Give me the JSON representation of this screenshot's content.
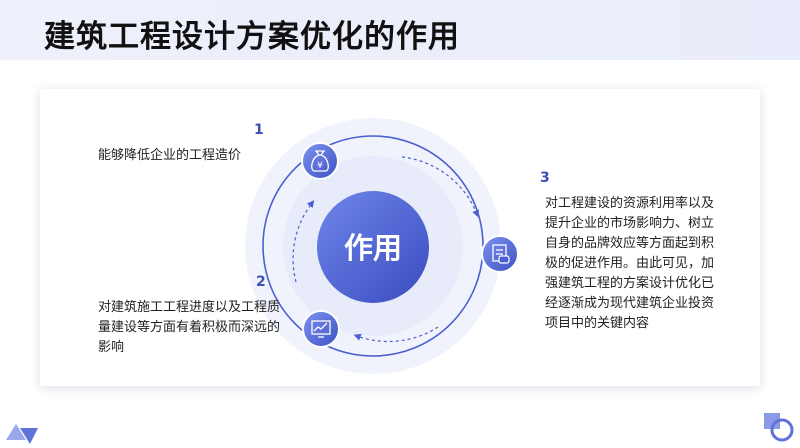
{
  "title": "建筑工程设计方案优化的作用",
  "center_label": "作用",
  "items": [
    {
      "number": "1",
      "text": "能够降低企业的工程造价",
      "icon": "money-bag-icon"
    },
    {
      "number": "2",
      "text": "对建筑施工工程进度以及工程质量建设等方面有着积极而深远的影响",
      "icon": "chart-monitor-icon"
    },
    {
      "number": "3",
      "text": "对工程建设的资源利用率以及提升企业的市场影响力、树立自身的品牌效应等方面起到积极的促进作用。由此可见，加强建筑工程的方案设计优化已经逐渐成为现代建筑企业投资项目中的关键内容",
      "icon": "document-chat-icon"
    }
  ],
  "colors": {
    "accent": "#3c4fb8",
    "accent_light": "#7e8fe0",
    "halo": "#eef1fc",
    "title_bg": "#eef0fb"
  }
}
